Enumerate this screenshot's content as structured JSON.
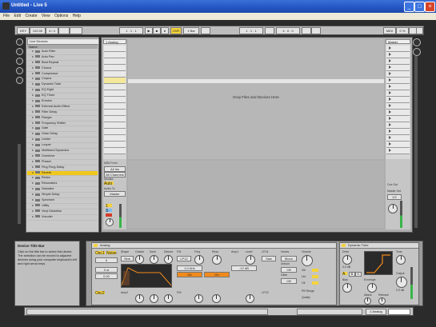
{
  "window": {
    "title": "Untitled - Live 5",
    "buttons": {
      "minimize": "_",
      "maximize": "□",
      "close": "×"
    }
  },
  "menu": [
    "File",
    "Edit",
    "Create",
    "View",
    "Options",
    "Help"
  ],
  "transport": {
    "tempo": "120.00",
    "signature": "4 / 4",
    "position": "1 . 1 . 1",
    "loop_start": "1 . 1 . 1",
    "loop_length": "4 . 0 . 0",
    "quantize": "1 Bar",
    "key": "KEY",
    "midi": "MIDI",
    "cpu": "0 %"
  },
  "browser": {
    "search_value": "Live Devices",
    "header": "Name",
    "items": [
      {
        "label": "Auto Filter",
        "selected": false
      },
      {
        "label": "Auto Pan",
        "selected": false
      },
      {
        "label": "Beat Repeat",
        "selected": false
      },
      {
        "label": "Chorus",
        "selected": false
      },
      {
        "label": "Compressor",
        "selected": false
      },
      {
        "label": "Corpus",
        "selected": false
      },
      {
        "label": "Dynamic Tube",
        "selected": false
      },
      {
        "label": "EQ Eight",
        "selected": false
      },
      {
        "label": "EQ Three",
        "selected": false
      },
      {
        "label": "Erosion",
        "selected": false
      },
      {
        "label": "External Audio Effect",
        "selected": false
      },
      {
        "label": "Filter Delay",
        "selected": false
      },
      {
        "label": "Flanger",
        "selected": false
      },
      {
        "label": "Frequency Shifter",
        "selected": false
      },
      {
        "label": "Gate",
        "selected": false
      },
      {
        "label": "Grain Delay",
        "selected": false
      },
      {
        "label": "Limiter",
        "selected": false
      },
      {
        "label": "Looper",
        "selected": false
      },
      {
        "label": "Multiband Dynamics",
        "selected": false
      },
      {
        "label": "Overdrive",
        "selected": false
      },
      {
        "label": "Phaser",
        "selected": false
      },
      {
        "label": "Ping Pong Delay",
        "selected": false
      },
      {
        "label": "Reverb",
        "selected": true
      },
      {
        "label": "Redux",
        "selected": false
      },
      {
        "label": "Resonators",
        "selected": false
      },
      {
        "label": "Saturator",
        "selected": false
      },
      {
        "label": "Simple Delay",
        "selected": false
      },
      {
        "label": "Spectrum",
        "selected": false
      },
      {
        "label": "Utility",
        "selected": false
      },
      {
        "label": "Vinyl Distortion",
        "selected": false
      },
      {
        "label": "Vocoder",
        "selected": false
      }
    ]
  },
  "session": {
    "track_name": "1 Analog",
    "master_name": "Master",
    "drop_text": "Drop Files and Devices Here",
    "midi_from": "MIDI From",
    "all_ins": "All Ins",
    "all_channels": "All Channels",
    "monitor": "Monitor",
    "auto": "Auto",
    "audio_to": "Audio To",
    "master_out": "Master",
    "sends_only": "Sends Only",
    "track_number": "1",
    "solo": "S",
    "master_pan_label": "Cue Out",
    "master_out_label": "Master Out",
    "master_out_value": "1/2"
  },
  "info_view": {
    "title": "Device Title Bar",
    "body": "Click on the title bar to select this device. The selection can be moved to adjacent devices using your computer keyboard's left and right arrow keys."
  },
  "devices": {
    "synth": {
      "name": "Analog",
      "osc1": "Osc1",
      "osc2": "Osc2",
      "noise": "Noise",
      "shape": "Shape",
      "octave": "Octave",
      "semi": "Semi",
      "detune": "Detune",
      "level": "Level",
      "freq": "Freq",
      "reso": "Reso",
      "filter1": "Fil1",
      "filter2": "Fil2",
      "amp1": "Amp1",
      "amp2": "Amp2",
      "lfo1": "LFO1",
      "lfo2": "LFO2",
      "voices": "Voices",
      "unison": "Unison",
      "glide": "Glide",
      "volume": "Volume",
      "vib": "Vib",
      "uni": "Uni",
      "gli": "Gli",
      "pitch_bend": "PB Range",
      "quality": "Quality",
      "mono": "Mono",
      "off": "Off",
      "sine": "Sine",
      "saw": "Saw",
      "lp12": "LP12",
      "on": "On",
      "freq_value": "1.0 kHz",
      "level_value": "-12 dB",
      "octave_value": "0",
      "semi_value": "0 st",
      "detune_value": "0.00"
    },
    "tube": {
      "name": "Dynamic Tube",
      "drive": "Drive",
      "bias": "Bias",
      "envelope": "Envelope",
      "attack": "Attack",
      "release": "Release",
      "tone": "Tone",
      "output": "Output",
      "tube_a": "A",
      "tube_b": "B",
      "tube_c": "C",
      "drive_value": "0.0 dB",
      "output_value": "0.0 dB"
    }
  },
  "status": {
    "text": "",
    "track_label": "1 Analog"
  }
}
